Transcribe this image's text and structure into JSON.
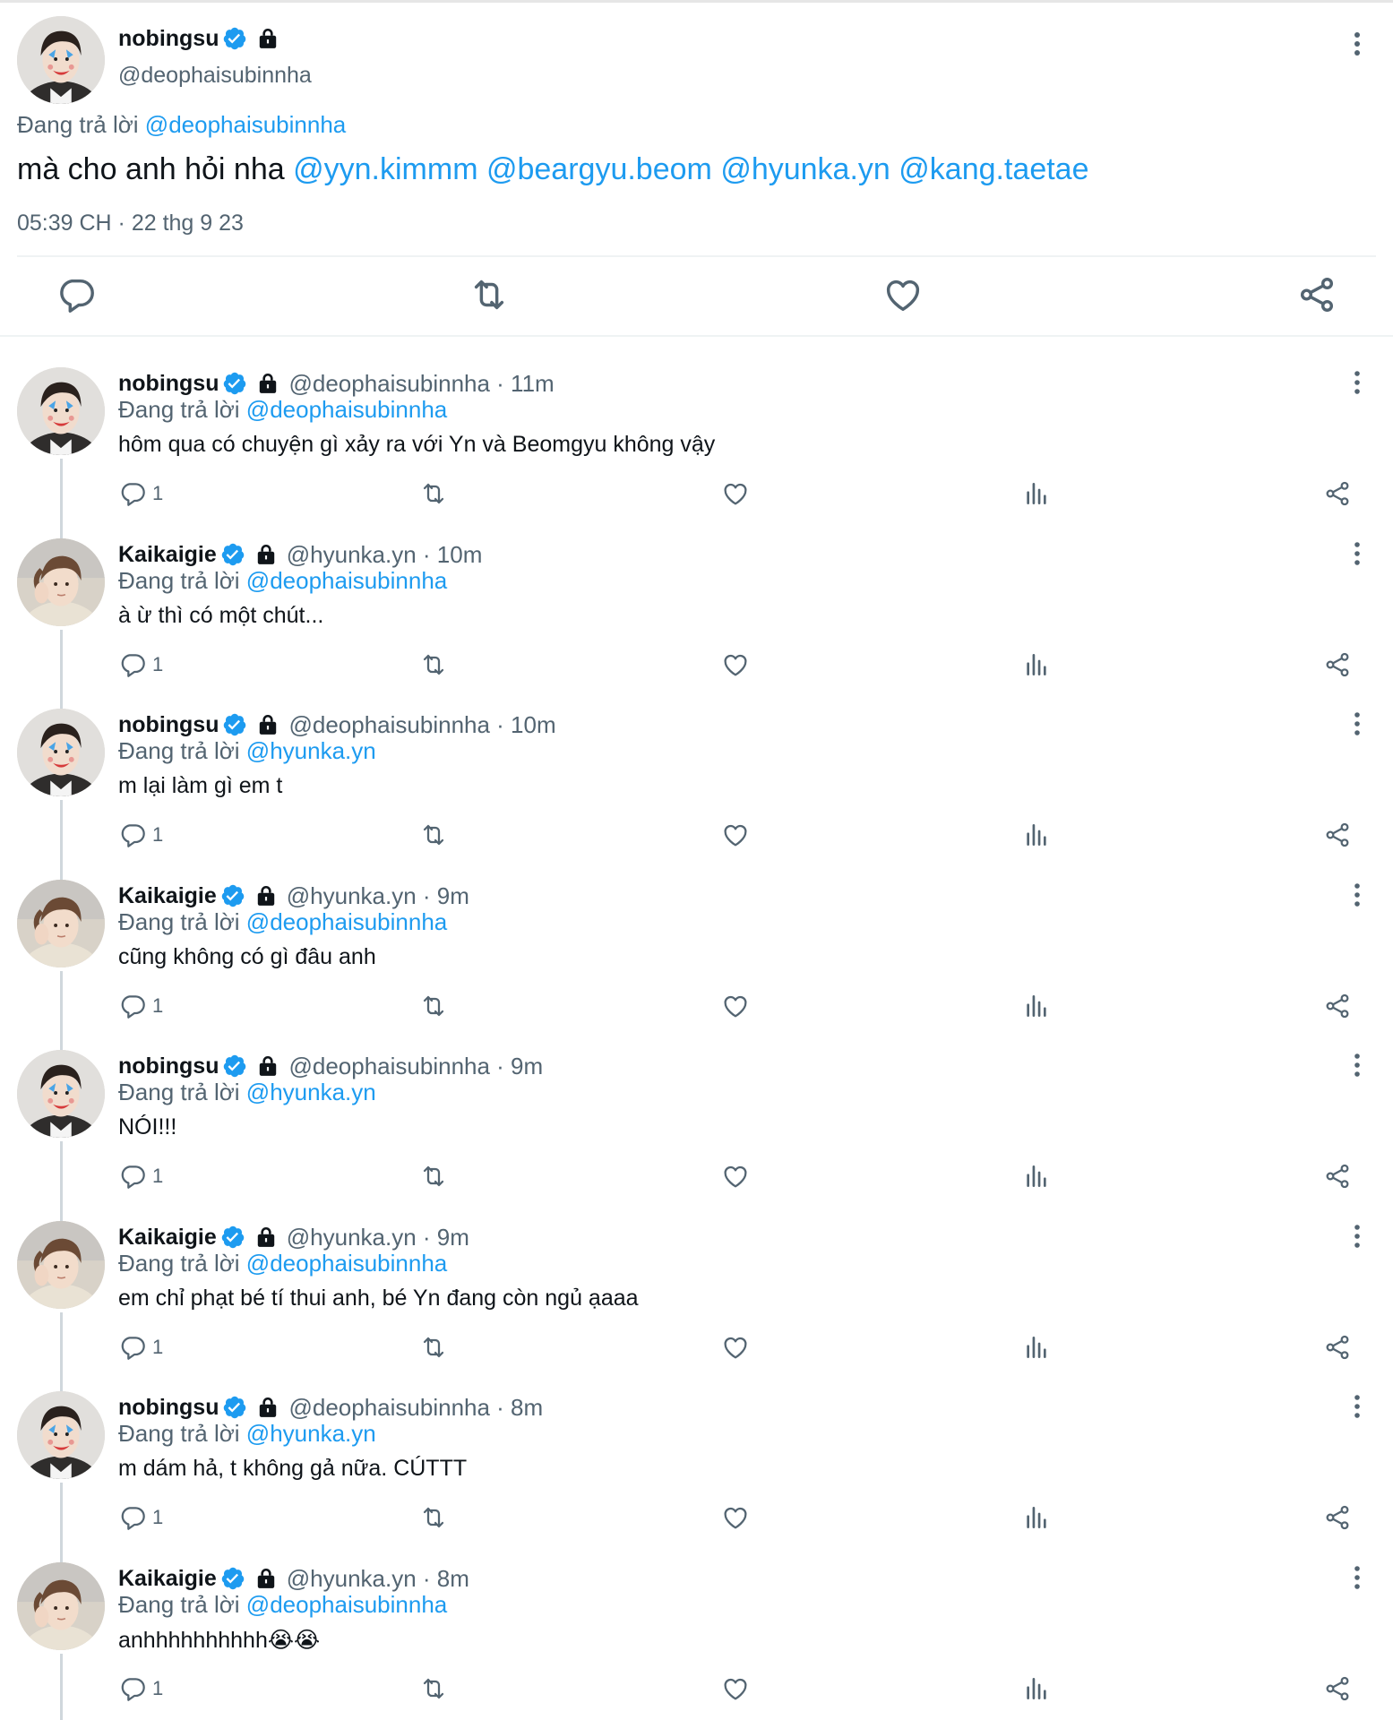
{
  "main_tweet": {
    "name": "nobingsu",
    "handle": "@deophaisubinnha",
    "reply_prefix": "Đang trả lời",
    "reply_to": "@deophaisubinnha",
    "text_prefix": "mà cho anh hỏi nha",
    "mentions": [
      "@yyn.kimmm",
      "@beargyu.beom",
      "@hyunka.yn",
      "@kang.taetae"
    ],
    "timestamp": "05:39 CH · 22 thg 9 23"
  },
  "replies": [
    {
      "name": "nobingsu",
      "handle_time": "@deophaisubinnha · 11m",
      "reply_prefix": "Đang trả lời",
      "reply_to": "@deophaisubinnha",
      "text": "hôm qua có chuyện gì xảy ra với Yn và Beomgyu không vậy",
      "reply_count": "1",
      "avatar": "nobingsu"
    },
    {
      "name": "Kaikaigie",
      "handle_time": "@hyunka.yn · 10m",
      "reply_prefix": "Đang trả lời",
      "reply_to": "@deophaisubinnha",
      "text": "à ừ thì có một chút...",
      "reply_count": "1",
      "avatar": "kaikaigie"
    },
    {
      "name": "nobingsu",
      "handle_time": "@deophaisubinnha · 10m",
      "reply_prefix": "Đang trả lời",
      "reply_to": "@hyunka.yn",
      "text": "m lại làm gì em t",
      "reply_count": "1",
      "avatar": "nobingsu"
    },
    {
      "name": "Kaikaigie",
      "handle_time": "@hyunka.yn · 9m",
      "reply_prefix": "Đang trả lời",
      "reply_to": "@deophaisubinnha",
      "text": "cũng không có gì đâu anh",
      "reply_count": "1",
      "avatar": "kaikaigie"
    },
    {
      "name": "nobingsu",
      "handle_time": "@deophaisubinnha · 9m",
      "reply_prefix": "Đang trả lời",
      "reply_to": "@hyunka.yn",
      "text": "NÓI!!!",
      "reply_count": "1",
      "avatar": "nobingsu"
    },
    {
      "name": "Kaikaigie",
      "handle_time": "@hyunka.yn · 9m",
      "reply_prefix": "Đang trả lời",
      "reply_to": "@deophaisubinnha",
      "text": "em chỉ phạt bé tí thui anh, bé Yn đang còn ngủ ạaaa",
      "reply_count": "1",
      "avatar": "kaikaigie"
    },
    {
      "name": "nobingsu",
      "handle_time": "@deophaisubinnha · 8m",
      "reply_prefix": "Đang trả lời",
      "reply_to": "@hyunka.yn",
      "text": "m dám hả, t không gả nữa. CÚTTT",
      "reply_count": "1",
      "avatar": "nobingsu"
    },
    {
      "name": "Kaikaigie",
      "handle_time": "@hyunka.yn · 8m",
      "reply_prefix": "Đang trả lời",
      "reply_to": "@deophaisubinnha",
      "text": "anhhhhhhhhhh😭😭",
      "reply_count": "1",
      "avatar": "kaikaigie"
    }
  ],
  "colors": {
    "link": "#1d9bf0",
    "secondary_text": "#536471",
    "verified": "#1d9bf0",
    "divider": "#eff3f4"
  },
  "icons": [
    "verified-icon",
    "lock-icon",
    "more-icon",
    "reply-icon",
    "retweet-icon",
    "like-icon",
    "views-icon",
    "share-icon"
  ]
}
